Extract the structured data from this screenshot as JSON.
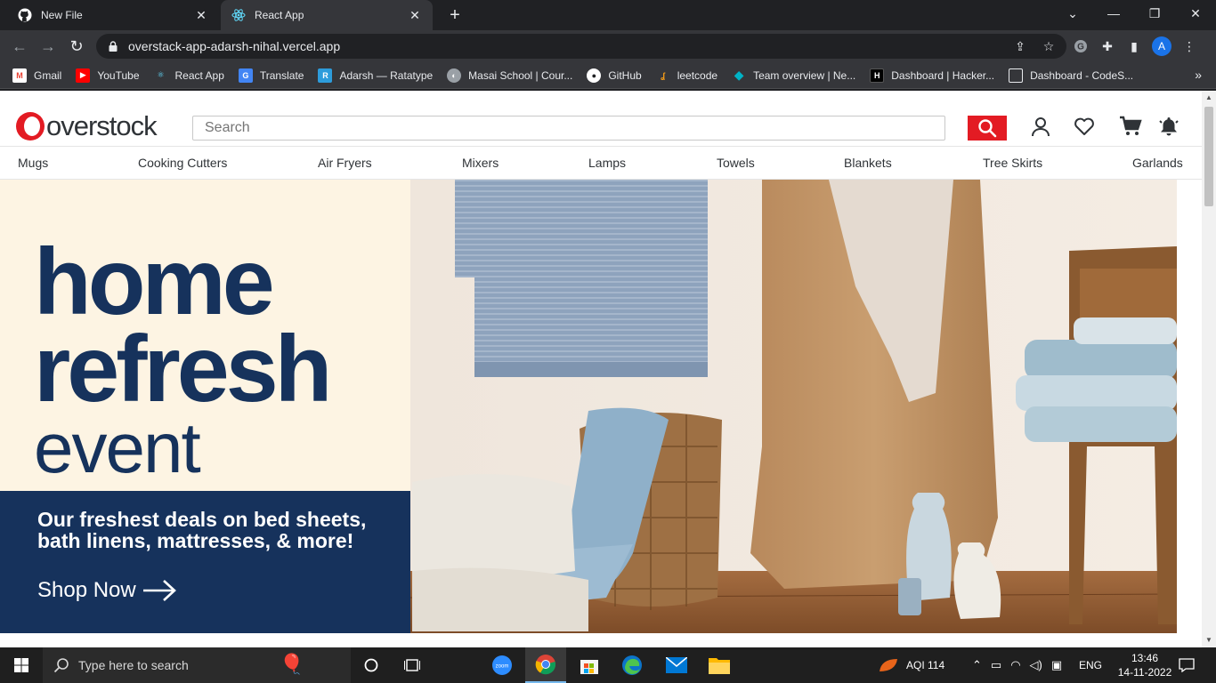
{
  "browser": {
    "tabs": [
      {
        "label": "New File",
        "icon": "github-icon"
      },
      {
        "label": "React App",
        "icon": "react-icon"
      }
    ],
    "url": "overstack-app-adarsh-nihal.vercel.app",
    "profile_initial": "A",
    "bookmarks": [
      {
        "label": "Gmail",
        "icon": "gmail-icon",
        "color": "#ea4335"
      },
      {
        "label": "YouTube",
        "icon": "youtube-icon",
        "color": "#ff0000"
      },
      {
        "label": "React App",
        "icon": "react-icon",
        "color": "#61dafb"
      },
      {
        "label": "Translate",
        "icon": "translate-icon",
        "color": "#4285f4"
      },
      {
        "label": "Adarsh — Ratatype",
        "icon": "ratatype-icon",
        "color": "#2d9cdb"
      },
      {
        "label": "Masai School | Cour...",
        "icon": "masai-icon",
        "color": "#9aa0a6"
      },
      {
        "label": "GitHub",
        "icon": "github-icon",
        "color": "#ffffff"
      },
      {
        "label": "leetcode",
        "icon": "leetcode-icon",
        "color": "#ffa116"
      },
      {
        "label": "Team overview | Ne...",
        "icon": "diamond-icon",
        "color": "#00b3c6"
      },
      {
        "label": "Dashboard | Hacker...",
        "icon": "hackerrank-icon",
        "color": "#000000"
      },
      {
        "label": "Dashboard - CodeS...",
        "icon": "page-icon",
        "color": "#9aa0a6"
      }
    ]
  },
  "site": {
    "logo_text": "overstock",
    "search_placeholder": "Search",
    "categories": [
      "Mugs",
      "Cooking Cutters",
      "Air Fryers",
      "Mixers",
      "Lamps",
      "Towels",
      "Blankets",
      "Tree Skirts",
      "Garlands"
    ],
    "hero": {
      "line1": "home",
      "line2": "refresh",
      "line3": "event",
      "tagline": "Our freshest deals on bed sheets, bath linens, mattresses, & more!",
      "cta": "Shop Now"
    },
    "colors": {
      "brand_red": "#e31b23",
      "navy": "#16325c",
      "cream": "#fdf4e3"
    }
  },
  "taskbar": {
    "search_placeholder": "Type here to search",
    "weather": "AQI 114",
    "language": "ENG",
    "time": "13:46",
    "date": "14-11-2022"
  }
}
